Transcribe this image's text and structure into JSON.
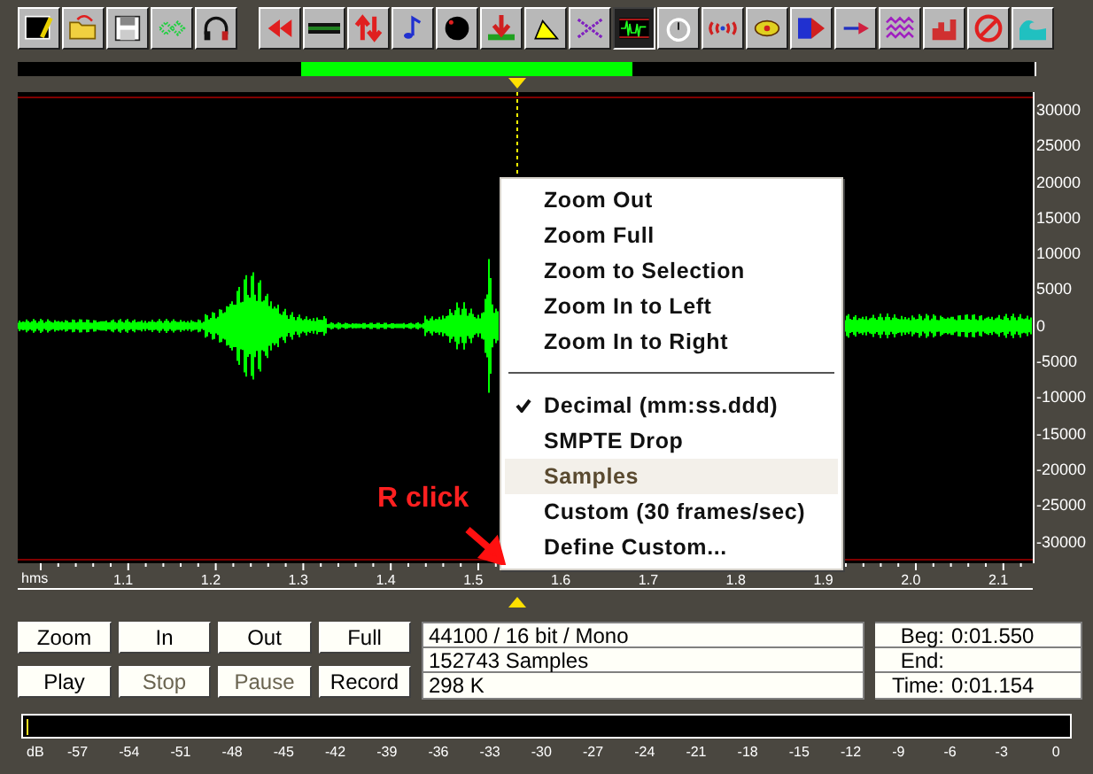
{
  "toolbar": [
    {
      "kind": "new",
      "pressed": false
    },
    {
      "kind": "open",
      "pressed": false
    },
    {
      "kind": "save",
      "pressed": false
    },
    {
      "kind": "dots",
      "pressed": false
    },
    {
      "kind": "headphones",
      "pressed": false
    },
    {
      "kind": "rewind",
      "pressed": false
    },
    {
      "kind": "bars",
      "pressed": false
    },
    {
      "kind": "swap",
      "pressed": false
    },
    {
      "kind": "note",
      "pressed": false
    },
    {
      "kind": "knob",
      "pressed": false
    },
    {
      "kind": "down",
      "pressed": false
    },
    {
      "kind": "triangle",
      "pressed": false
    },
    {
      "kind": "cross",
      "pressed": false
    },
    {
      "kind": "wave",
      "pressed": true
    },
    {
      "kind": "stopwatch",
      "pressed": false
    },
    {
      "kind": "ripple",
      "pressed": false
    },
    {
      "kind": "eye",
      "pressed": false
    },
    {
      "kind": "grid",
      "pressed": false
    },
    {
      "kind": "arrow",
      "pressed": false
    },
    {
      "kind": "zigzag",
      "pressed": false
    },
    {
      "kind": "histogram",
      "pressed": false
    },
    {
      "kind": "forbidden",
      "pressed": false
    },
    {
      "kind": "sea",
      "pressed": false
    }
  ],
  "y_axis": [
    "30000",
    "25000",
    "20000",
    "15000",
    "10000",
    "5000",
    "0",
    "-5000",
    "-10000",
    "-15000",
    "-20000",
    "-25000",
    "-30000"
  ],
  "time_axis": {
    "unit": "hms",
    "labels": [
      "1.1",
      "1.2",
      "1.3",
      "1.4",
      "1.5",
      "1.6",
      "1.7",
      "1.8",
      "1.9",
      "2.0",
      "2.1"
    ]
  },
  "context_menu": [
    {
      "label": "Zoom Out",
      "checked": false,
      "hovered": false,
      "separator_after": false
    },
    {
      "label": "Zoom Full",
      "checked": false,
      "hovered": false,
      "separator_after": false
    },
    {
      "label": "Zoom to Selection",
      "checked": false,
      "hovered": false,
      "separator_after": false
    },
    {
      "label": "Zoom In to Left",
      "checked": false,
      "hovered": false,
      "separator_after": false
    },
    {
      "label": "Zoom In to Right",
      "checked": false,
      "hovered": false,
      "separator_after": true
    },
    {
      "label": "Decimal (mm:ss.ddd)",
      "checked": true,
      "hovered": false,
      "separator_after": false
    },
    {
      "label": "SMPTE Drop",
      "checked": false,
      "hovered": false,
      "separator_after": false
    },
    {
      "label": "Samples",
      "checked": false,
      "hovered": true,
      "separator_after": false
    },
    {
      "label": "Custom (30 frames/sec)",
      "checked": false,
      "hovered": false,
      "separator_after": false
    },
    {
      "label": "Define Custom...",
      "checked": false,
      "hovered": false,
      "separator_after": false
    }
  ],
  "annotation": "R click",
  "buttons": [
    {
      "label": "Zoom",
      "disabled": false
    },
    {
      "label": "In",
      "disabled": false
    },
    {
      "label": "Out",
      "disabled": false
    },
    {
      "label": "Full",
      "disabled": false
    },
    {
      "label": "Play",
      "disabled": false
    },
    {
      "label": "Stop",
      "disabled": true
    },
    {
      "label": "Pause",
      "disabled": true
    },
    {
      "label": "Record",
      "disabled": false
    }
  ],
  "info": [
    "44100 / 16 bit / Mono",
    "152743 Samples",
    "298 K"
  ],
  "position": [
    {
      "label": "Beg:",
      "value": "0:01.550"
    },
    {
      "label": "End:"
    },
    {
      "label": "Time:",
      "value": "0:01.154"
    }
  ],
  "meter": {
    "unit": "dB",
    "labels": [
      "-57",
      "-54",
      "-51",
      "-48",
      "-45",
      "-42",
      "-39",
      "-36",
      "-33",
      "-30",
      "-27",
      "-24",
      "-21",
      "-18",
      "-15",
      "-12",
      "-9",
      "-6",
      "-3",
      "0"
    ]
  }
}
